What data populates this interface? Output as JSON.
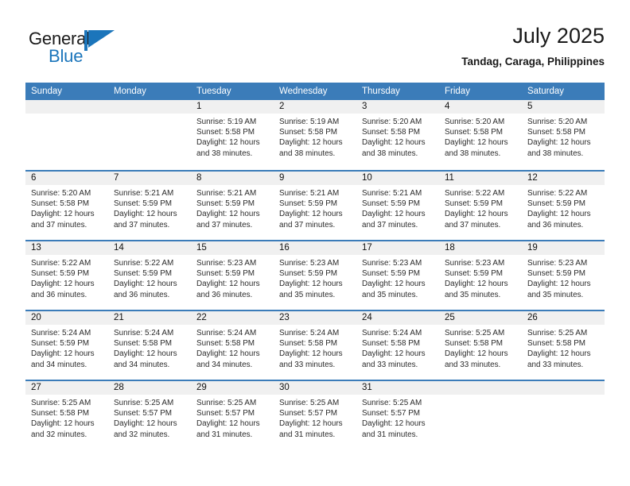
{
  "brand": {
    "name_part1": "General",
    "name_part2": "Blue",
    "mark": "flag-triangle-logo"
  },
  "header": {
    "month_title": "July 2025",
    "location": "Tandag, Caraga, Philippines"
  },
  "calendar": {
    "day_headers": [
      "Sunday",
      "Monday",
      "Tuesday",
      "Wednesday",
      "Thursday",
      "Friday",
      "Saturday"
    ],
    "accent_color": "#3b7cb9",
    "band_color": "#f0f0f0",
    "weeks": [
      [
        {
          "day": "",
          "sunrise": "",
          "sunset": "",
          "daylight_line1": "",
          "daylight_line2": ""
        },
        {
          "day": "",
          "sunrise": "",
          "sunset": "",
          "daylight_line1": "",
          "daylight_line2": ""
        },
        {
          "day": "1",
          "sunrise": "Sunrise: 5:19 AM",
          "sunset": "Sunset: 5:58 PM",
          "daylight_line1": "Daylight: 12 hours",
          "daylight_line2": "and 38 minutes."
        },
        {
          "day": "2",
          "sunrise": "Sunrise: 5:19 AM",
          "sunset": "Sunset: 5:58 PM",
          "daylight_line1": "Daylight: 12 hours",
          "daylight_line2": "and 38 minutes."
        },
        {
          "day": "3",
          "sunrise": "Sunrise: 5:20 AM",
          "sunset": "Sunset: 5:58 PM",
          "daylight_line1": "Daylight: 12 hours",
          "daylight_line2": "and 38 minutes."
        },
        {
          "day": "4",
          "sunrise": "Sunrise: 5:20 AM",
          "sunset": "Sunset: 5:58 PM",
          "daylight_line1": "Daylight: 12 hours",
          "daylight_line2": "and 38 minutes."
        },
        {
          "day": "5",
          "sunrise": "Sunrise: 5:20 AM",
          "sunset": "Sunset: 5:58 PM",
          "daylight_line1": "Daylight: 12 hours",
          "daylight_line2": "and 38 minutes."
        }
      ],
      [
        {
          "day": "6",
          "sunrise": "Sunrise: 5:20 AM",
          "sunset": "Sunset: 5:58 PM",
          "daylight_line1": "Daylight: 12 hours",
          "daylight_line2": "and 37 minutes."
        },
        {
          "day": "7",
          "sunrise": "Sunrise: 5:21 AM",
          "sunset": "Sunset: 5:59 PM",
          "daylight_line1": "Daylight: 12 hours",
          "daylight_line2": "and 37 minutes."
        },
        {
          "day": "8",
          "sunrise": "Sunrise: 5:21 AM",
          "sunset": "Sunset: 5:59 PM",
          "daylight_line1": "Daylight: 12 hours",
          "daylight_line2": "and 37 minutes."
        },
        {
          "day": "9",
          "sunrise": "Sunrise: 5:21 AM",
          "sunset": "Sunset: 5:59 PM",
          "daylight_line1": "Daylight: 12 hours",
          "daylight_line2": "and 37 minutes."
        },
        {
          "day": "10",
          "sunrise": "Sunrise: 5:21 AM",
          "sunset": "Sunset: 5:59 PM",
          "daylight_line1": "Daylight: 12 hours",
          "daylight_line2": "and 37 minutes."
        },
        {
          "day": "11",
          "sunrise": "Sunrise: 5:22 AM",
          "sunset": "Sunset: 5:59 PM",
          "daylight_line1": "Daylight: 12 hours",
          "daylight_line2": "and 37 minutes."
        },
        {
          "day": "12",
          "sunrise": "Sunrise: 5:22 AM",
          "sunset": "Sunset: 5:59 PM",
          "daylight_line1": "Daylight: 12 hours",
          "daylight_line2": "and 36 minutes."
        }
      ],
      [
        {
          "day": "13",
          "sunrise": "Sunrise: 5:22 AM",
          "sunset": "Sunset: 5:59 PM",
          "daylight_line1": "Daylight: 12 hours",
          "daylight_line2": "and 36 minutes."
        },
        {
          "day": "14",
          "sunrise": "Sunrise: 5:22 AM",
          "sunset": "Sunset: 5:59 PM",
          "daylight_line1": "Daylight: 12 hours",
          "daylight_line2": "and 36 minutes."
        },
        {
          "day": "15",
          "sunrise": "Sunrise: 5:23 AM",
          "sunset": "Sunset: 5:59 PM",
          "daylight_line1": "Daylight: 12 hours",
          "daylight_line2": "and 36 minutes."
        },
        {
          "day": "16",
          "sunrise": "Sunrise: 5:23 AM",
          "sunset": "Sunset: 5:59 PM",
          "daylight_line1": "Daylight: 12 hours",
          "daylight_line2": "and 35 minutes."
        },
        {
          "day": "17",
          "sunrise": "Sunrise: 5:23 AM",
          "sunset": "Sunset: 5:59 PM",
          "daylight_line1": "Daylight: 12 hours",
          "daylight_line2": "and 35 minutes."
        },
        {
          "day": "18",
          "sunrise": "Sunrise: 5:23 AM",
          "sunset": "Sunset: 5:59 PM",
          "daylight_line1": "Daylight: 12 hours",
          "daylight_line2": "and 35 minutes."
        },
        {
          "day": "19",
          "sunrise": "Sunrise: 5:23 AM",
          "sunset": "Sunset: 5:59 PM",
          "daylight_line1": "Daylight: 12 hours",
          "daylight_line2": "and 35 minutes."
        }
      ],
      [
        {
          "day": "20",
          "sunrise": "Sunrise: 5:24 AM",
          "sunset": "Sunset: 5:59 PM",
          "daylight_line1": "Daylight: 12 hours",
          "daylight_line2": "and 34 minutes."
        },
        {
          "day": "21",
          "sunrise": "Sunrise: 5:24 AM",
          "sunset": "Sunset: 5:58 PM",
          "daylight_line1": "Daylight: 12 hours",
          "daylight_line2": "and 34 minutes."
        },
        {
          "day": "22",
          "sunrise": "Sunrise: 5:24 AM",
          "sunset": "Sunset: 5:58 PM",
          "daylight_line1": "Daylight: 12 hours",
          "daylight_line2": "and 34 minutes."
        },
        {
          "day": "23",
          "sunrise": "Sunrise: 5:24 AM",
          "sunset": "Sunset: 5:58 PM",
          "daylight_line1": "Daylight: 12 hours",
          "daylight_line2": "and 33 minutes."
        },
        {
          "day": "24",
          "sunrise": "Sunrise: 5:24 AM",
          "sunset": "Sunset: 5:58 PM",
          "daylight_line1": "Daylight: 12 hours",
          "daylight_line2": "and 33 minutes."
        },
        {
          "day": "25",
          "sunrise": "Sunrise: 5:25 AM",
          "sunset": "Sunset: 5:58 PM",
          "daylight_line1": "Daylight: 12 hours",
          "daylight_line2": "and 33 minutes."
        },
        {
          "day": "26",
          "sunrise": "Sunrise: 5:25 AM",
          "sunset": "Sunset: 5:58 PM",
          "daylight_line1": "Daylight: 12 hours",
          "daylight_line2": "and 33 minutes."
        }
      ],
      [
        {
          "day": "27",
          "sunrise": "Sunrise: 5:25 AM",
          "sunset": "Sunset: 5:58 PM",
          "daylight_line1": "Daylight: 12 hours",
          "daylight_line2": "and 32 minutes."
        },
        {
          "day": "28",
          "sunrise": "Sunrise: 5:25 AM",
          "sunset": "Sunset: 5:57 PM",
          "daylight_line1": "Daylight: 12 hours",
          "daylight_line2": "and 32 minutes."
        },
        {
          "day": "29",
          "sunrise": "Sunrise: 5:25 AM",
          "sunset": "Sunset: 5:57 PM",
          "daylight_line1": "Daylight: 12 hours",
          "daylight_line2": "and 31 minutes."
        },
        {
          "day": "30",
          "sunrise": "Sunrise: 5:25 AM",
          "sunset": "Sunset: 5:57 PM",
          "daylight_line1": "Daylight: 12 hours",
          "daylight_line2": "and 31 minutes."
        },
        {
          "day": "31",
          "sunrise": "Sunrise: 5:25 AM",
          "sunset": "Sunset: 5:57 PM",
          "daylight_line1": "Daylight: 12 hours",
          "daylight_line2": "and 31 minutes."
        },
        {
          "day": "",
          "sunrise": "",
          "sunset": "",
          "daylight_line1": "",
          "daylight_line2": ""
        },
        {
          "day": "",
          "sunrise": "",
          "sunset": "",
          "daylight_line1": "",
          "daylight_line2": ""
        }
      ]
    ]
  }
}
